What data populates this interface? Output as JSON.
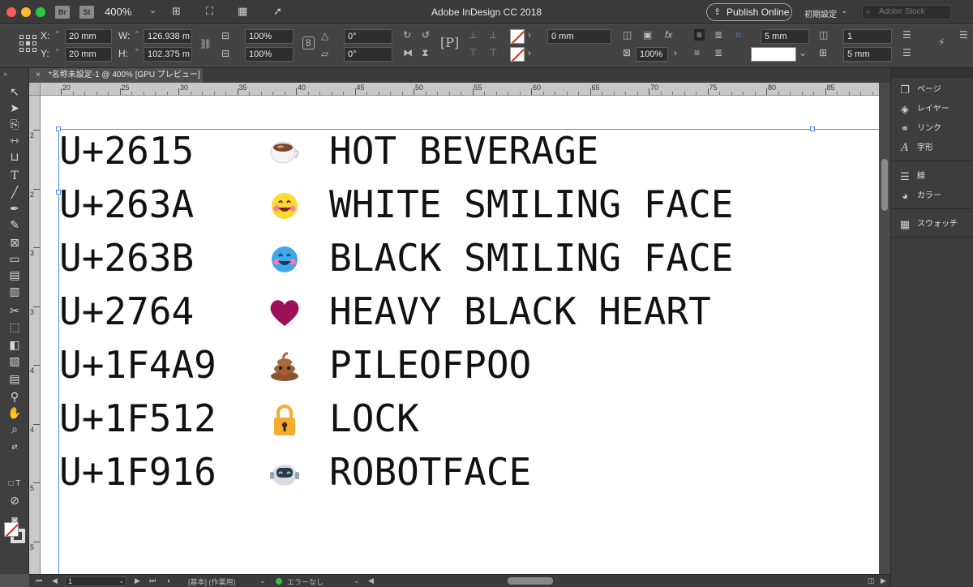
{
  "titlebar": {
    "app_badges": [
      "Br",
      "St"
    ],
    "zoom": "400%",
    "title": "Adobe InDesign CC 2018",
    "publish_label": "Publish Online",
    "workspace": "初期設定",
    "stock_placeholder": "Adobe Stock"
  },
  "control": {
    "x_label": "X:",
    "x_value": "20 mm",
    "y_label": "Y:",
    "y_value": "20 mm",
    "w_label": "W:",
    "w_value": "126.938 m",
    "h_label": "H:",
    "h_value": "102.375 m",
    "scale_x": "100%",
    "scale_y": "100%",
    "rotate": "0°",
    "shear": "0°",
    "stroke_weight": "0 mm",
    "opacity": "100%",
    "offset_top": "5 mm",
    "columns": "1",
    "gutter": "5 mm"
  },
  "tab": {
    "close": "×",
    "label": "*名称未設定-1 @ 400% [GPU プレビュー]"
  },
  "ruler": {
    "h_labels": [
      "20",
      "25",
      "30",
      "35",
      "40",
      "45",
      "50",
      "55",
      "60",
      "65",
      "70",
      "75",
      "80",
      "85"
    ],
    "v_labels": [
      "2",
      "2",
      "3",
      "3",
      "4",
      "4",
      "5",
      "5"
    ]
  },
  "rows": [
    {
      "code": "U+2615",
      "emoji": "hot-beverage",
      "name": "HOT BEVERAGE"
    },
    {
      "code": "U+263A",
      "emoji": "white-smiling-face",
      "name": "WHITE SMILING FACE"
    },
    {
      "code": "U+263B",
      "emoji": "black-smiling-face",
      "name": "BLACK SMILING FACE"
    },
    {
      "code": "U+2764",
      "emoji": "heavy-black-heart",
      "name": "HEAVY BLACK HEART"
    },
    {
      "code": "U+1F4A9",
      "emoji": "pile-of-poo",
      "name": "PILEOFPOO"
    },
    {
      "code": "U+1F512",
      "emoji": "lock",
      "name": "LOCK"
    },
    {
      "code": "U+1F916",
      "emoji": "robot-face",
      "name": "ROBOTFACE"
    }
  ],
  "status": {
    "page": "1",
    "preflight_profile": "[基本] (作業用)",
    "errors": "エラーなし"
  },
  "panels": [
    {
      "label": "ページ",
      "icon": "pages-icon"
    },
    {
      "label": "レイヤー",
      "icon": "layers-icon"
    },
    {
      "label": "リンク",
      "icon": "links-icon"
    },
    {
      "label": "字形",
      "icon": "glyphs-icon"
    },
    {
      "label": "線",
      "icon": "stroke-icon"
    },
    {
      "label": "カラー",
      "icon": "color-icon"
    },
    {
      "label": "スウォッチ",
      "icon": "swatches-icon"
    }
  ],
  "colors": {
    "selection": "#4c8bf5",
    "heart": "#9c1057",
    "lock": "#f5ac32",
    "smile_yellow": "#ffd92e",
    "smile_blue": "#3fa9e8"
  }
}
